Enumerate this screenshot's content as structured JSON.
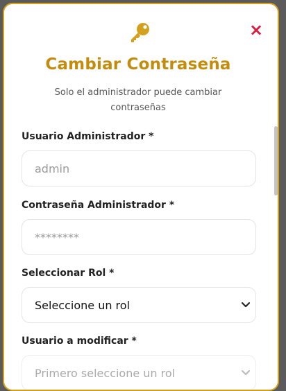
{
  "modal": {
    "title": "Cambiar Contraseña",
    "subtitle": "Solo el administrador puede cambiar contraseñas",
    "close_label": "×"
  },
  "fields": {
    "admin_user": {
      "label": "Usuario Administrador *",
      "placeholder": "admin"
    },
    "admin_password": {
      "label": "Contraseña Administrador *",
      "placeholder": "********"
    },
    "role": {
      "label": "Seleccionar Rol *",
      "selected": "Seleccione un rol"
    },
    "target_user": {
      "label": "Usuario a modificar *",
      "selected": "Primero seleccione un rol"
    }
  },
  "colors": {
    "accent": "#c48c0f",
    "border": "#d4a11e",
    "close": "#e0173a"
  },
  "icons": {
    "header": "key-icon",
    "close": "close-icon",
    "select": "chevron-down-icon"
  }
}
